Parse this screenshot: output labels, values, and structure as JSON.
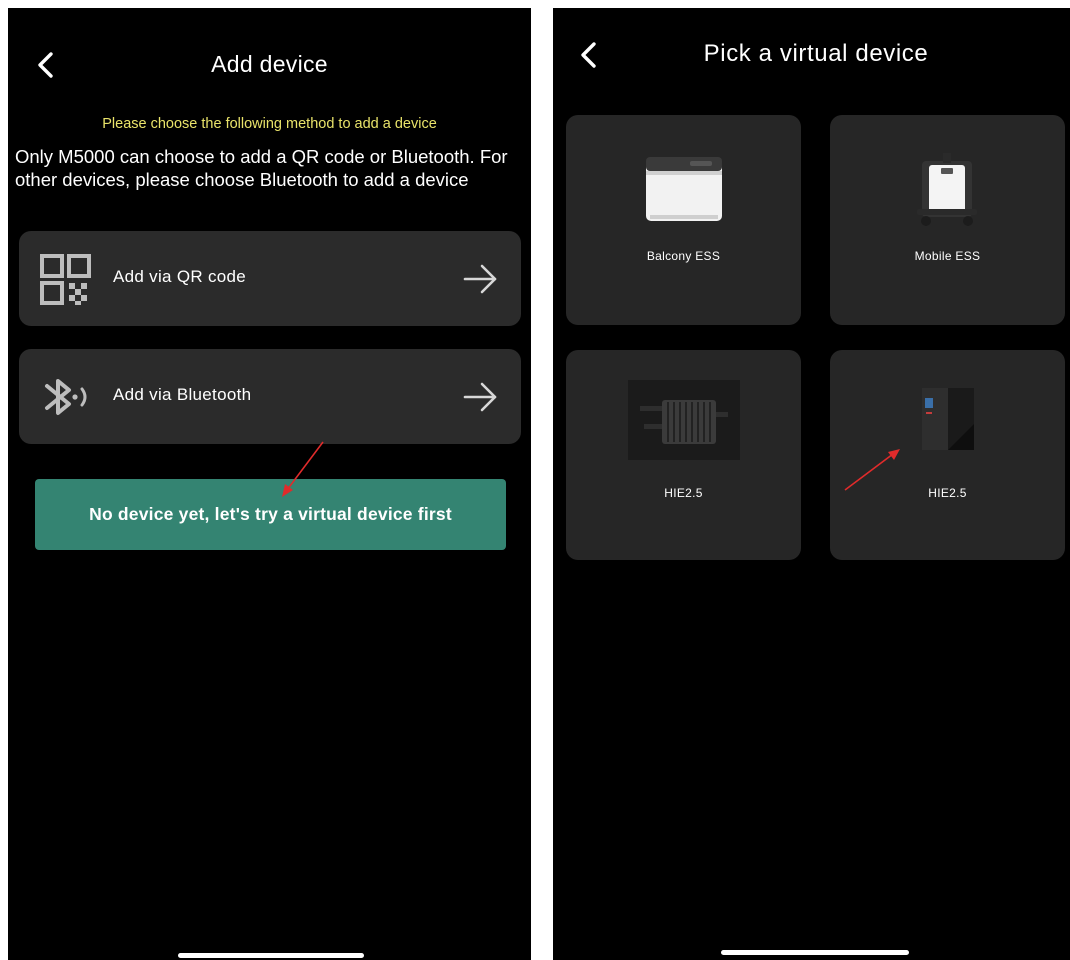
{
  "add_device": {
    "title": "Add device",
    "hint": "Please choose the following method to add a device",
    "description": "Only M5000 can choose to add a QR code or Bluetooth. For other devices, please choose Bluetooth to add a device",
    "methods": [
      {
        "label": "Add via QR code",
        "icon": "qr-code-icon"
      },
      {
        "label": "Add via Bluetooth",
        "icon": "bluetooth-icon"
      }
    ],
    "cta_label": "No device yet, let's try a virtual device first",
    "colors": {
      "hint": "#e9e36a",
      "cta_bg": "#348472",
      "card_bg": "#2b2b2b",
      "pointer": "#e02b2b"
    }
  },
  "pick_virtual_device": {
    "title": "Pick a virtual device",
    "devices": [
      {
        "label": "Balcony ESS"
      },
      {
        "label": "Mobile ESS"
      },
      {
        "label": "HIE2.5"
      },
      {
        "label": "HIE2.5"
      }
    ]
  }
}
